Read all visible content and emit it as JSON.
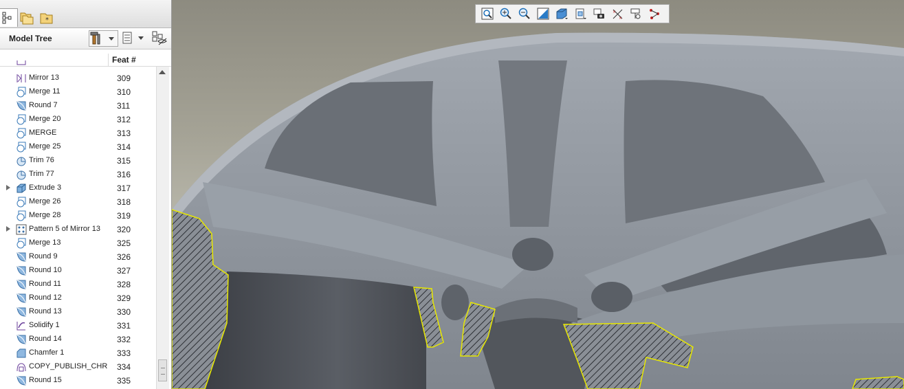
{
  "model_tree": {
    "title": "Model Tree",
    "column_feat": "Feat #",
    "rows": [
      {
        "name": "Mirror 13",
        "feat": "309",
        "icon": "mirror-icon",
        "expandable": false
      },
      {
        "name": "Merge 11",
        "feat": "310",
        "icon": "merge-icon",
        "expandable": false
      },
      {
        "name": "Round 7",
        "feat": "311",
        "icon": "round-icon",
        "expandable": false
      },
      {
        "name": "Merge 20",
        "feat": "312",
        "icon": "merge-icon",
        "expandable": false
      },
      {
        "name": "MERGE",
        "feat": "313",
        "icon": "merge-icon",
        "expandable": false
      },
      {
        "name": "Merge 25",
        "feat": "314",
        "icon": "merge-icon",
        "expandable": false
      },
      {
        "name": "Trim 76",
        "feat": "315",
        "icon": "trim-icon",
        "expandable": false
      },
      {
        "name": "Trim 77",
        "feat": "316",
        "icon": "trim-icon",
        "expandable": false
      },
      {
        "name": "Extrude 3",
        "feat": "317",
        "icon": "extrude-icon",
        "expandable": true
      },
      {
        "name": "Merge 26",
        "feat": "318",
        "icon": "merge-icon",
        "expandable": false
      },
      {
        "name": "Merge 28",
        "feat": "319",
        "icon": "merge-icon",
        "expandable": false
      },
      {
        "name": "Pattern 5 of Mirror 13",
        "feat": "320",
        "icon": "pattern-icon",
        "expandable": true
      },
      {
        "name": "Merge 13",
        "feat": "325",
        "icon": "merge-icon",
        "expandable": false
      },
      {
        "name": "Round 9",
        "feat": "326",
        "icon": "round-icon",
        "expandable": false
      },
      {
        "name": "Round 10",
        "feat": "327",
        "icon": "round-icon",
        "expandable": false
      },
      {
        "name": "Round 11",
        "feat": "328",
        "icon": "round-icon",
        "expandable": false
      },
      {
        "name": "Round 12",
        "feat": "329",
        "icon": "round-icon",
        "expandable": false
      },
      {
        "name": "Round 13",
        "feat": "330",
        "icon": "round-icon",
        "expandable": false
      },
      {
        "name": "Solidify 1",
        "feat": "331",
        "icon": "solidify-icon",
        "expandable": false
      },
      {
        "name": "Round 14",
        "feat": "332",
        "icon": "round-icon",
        "expandable": false
      },
      {
        "name": "Chamfer 1",
        "feat": "333",
        "icon": "chamfer-icon",
        "expandable": false
      },
      {
        "name": "COPY_PUBLISH_CHROM",
        "feat": "334",
        "icon": "copy-geometry-icon",
        "expandable": false
      },
      {
        "name": "Round 15",
        "feat": "335",
        "icon": "round-icon",
        "expandable": false
      }
    ]
  },
  "tabs": [
    "model-tree-tab-icon",
    "folder-browser-tab-icon",
    "favorites-tab-icon"
  ],
  "view_toolbar": [
    "refit-icon",
    "zoom-in-icon",
    "zoom-out-icon",
    "repaint-icon",
    "display-style-icon",
    "saved-views-icon",
    "view-manager-icon",
    "datum-display-icon",
    "annotation-display-icon",
    "spin-center-icon"
  ],
  "colors": {
    "part_surface": "#8e949c",
    "section_hatch_edge": "#e8e800",
    "viewport_background": "#a5a396"
  }
}
